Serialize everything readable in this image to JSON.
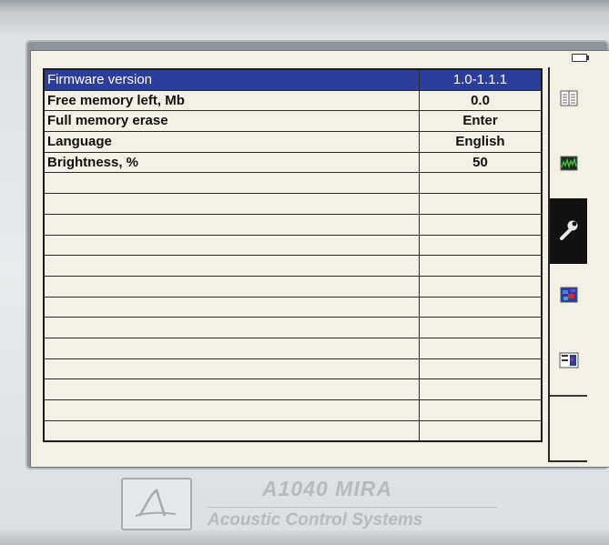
{
  "device": {
    "model": "A1040 MIRA",
    "company": "Acoustic Control Systems"
  },
  "status": {
    "battery_icon": "battery-icon"
  },
  "settings": {
    "rows": [
      {
        "label": "Firmware version",
        "value": "1.0-1.1.1",
        "selected": true
      },
      {
        "label": "Free memory left, Mb",
        "value": "0.0"
      },
      {
        "label": "Full memory erase",
        "value": "Enter"
      },
      {
        "label": "Language",
        "value": "English"
      },
      {
        "label": "Brightness, %",
        "value": "50"
      },
      {
        "label": "",
        "value": ""
      },
      {
        "label": "",
        "value": ""
      },
      {
        "label": "",
        "value": ""
      },
      {
        "label": "",
        "value": ""
      },
      {
        "label": "",
        "value": ""
      },
      {
        "label": "",
        "value": ""
      },
      {
        "label": "",
        "value": ""
      },
      {
        "label": "",
        "value": ""
      },
      {
        "label": "",
        "value": ""
      },
      {
        "label": "",
        "value": ""
      },
      {
        "label": "",
        "value": ""
      },
      {
        "label": "",
        "value": ""
      },
      {
        "label": "",
        "value": ""
      }
    ]
  },
  "sidebar": {
    "tabs": [
      {
        "icon": "document-list-icon",
        "active": false
      },
      {
        "icon": "waveform-image-icon",
        "active": false
      },
      {
        "icon": "wrench-icon",
        "active": true
      },
      {
        "icon": "color-map-icon",
        "active": false
      },
      {
        "icon": "report-layout-icon",
        "active": false
      }
    ]
  },
  "colors": {
    "selected_row": "#2c3e9b",
    "screen_bg": "#f3f1e6",
    "active_tab": "#111111"
  }
}
